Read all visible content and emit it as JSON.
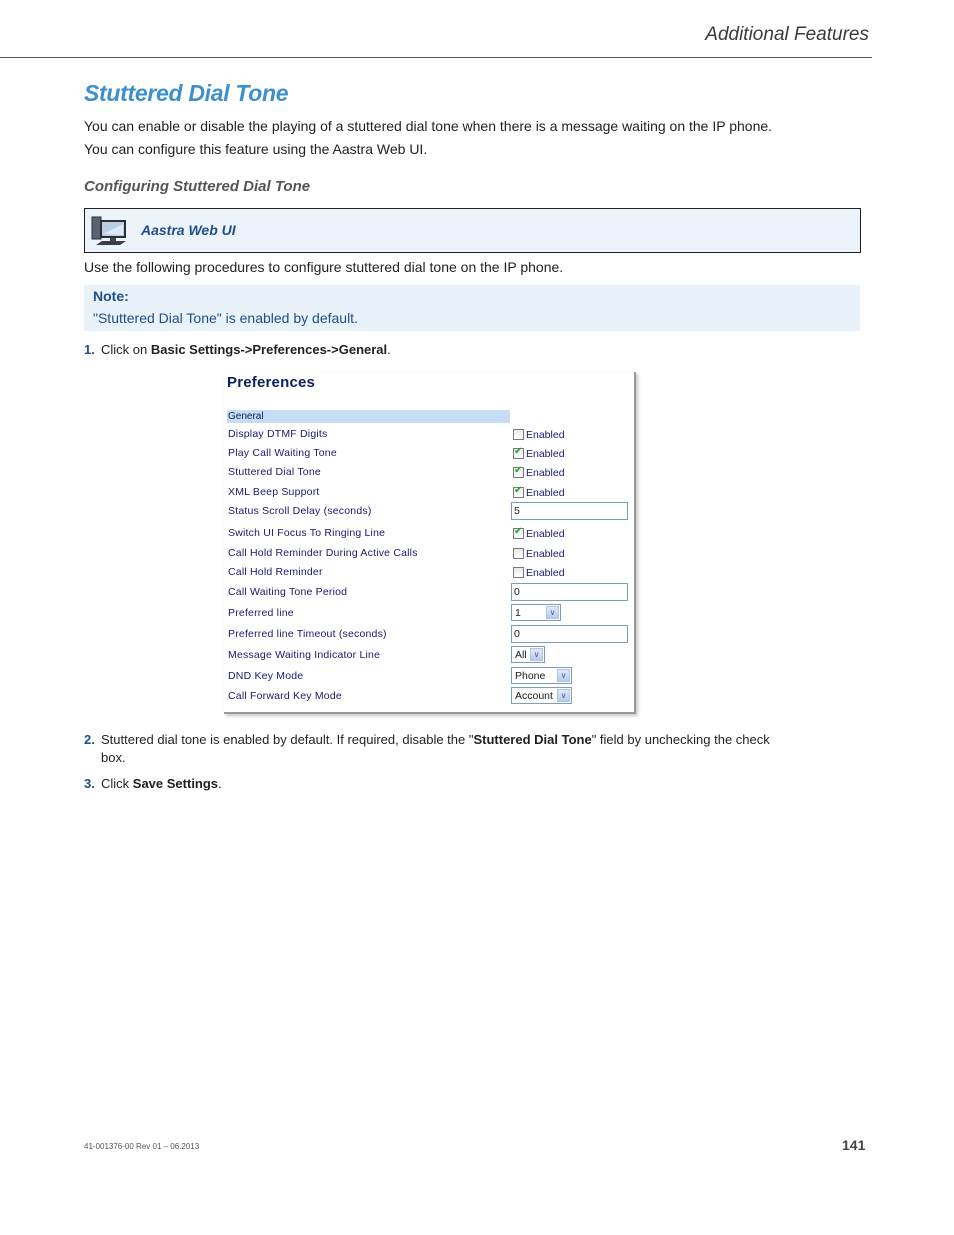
{
  "header": {
    "section_title": "Additional Features"
  },
  "page_title": "Stuttered Dial Tone",
  "intro": [
    "You can enable or disable the playing of a stuttered dial tone when there is a message waiting on the IP phone.",
    "You can configure this feature using the Aastra Web UI."
  ],
  "sub_heading": "Configuring Stuttered Dial Tone",
  "webui_box": {
    "icon": "computer-icon",
    "label": "Aastra Web UI"
  },
  "procedure_intro": "Use the following procedures to configure stuttered dial tone on the IP phone.",
  "note": {
    "title": "Note:",
    "text": "\"Stuttered Dial Tone\" is enabled by default."
  },
  "steps": [
    {
      "num": "1.",
      "pre": "Click on ",
      "bold": "Basic Settings->Preferences->General",
      "post": "."
    },
    {
      "num": "2.",
      "pre": "Stuttered dial tone is enabled by default. If required, disable the \"",
      "bold": "Stuttered Dial Tone",
      "post": "\" field by unchecking the check",
      "post2": "box."
    },
    {
      "num": "3.",
      "pre": "Click ",
      "bold": "Save Settings",
      "post": "."
    }
  ],
  "preferences": {
    "title": "Preferences",
    "section": "General",
    "rows": [
      {
        "label": "Display DTMF Digits",
        "type": "checkbox",
        "checked": false,
        "text": "Enabled"
      },
      {
        "label": "Play Call Waiting Tone",
        "type": "checkbox",
        "checked": true,
        "text": "Enabled"
      },
      {
        "label": "Stuttered Dial Tone",
        "type": "checkbox",
        "checked": true,
        "text": "Enabled"
      },
      {
        "label": "XML Beep Support",
        "type": "checkbox",
        "checked": true,
        "text": "Enabled"
      },
      {
        "label": "Status Scroll Delay (seconds)",
        "type": "text",
        "value": "5"
      },
      {
        "label": "Switch UI Focus To Ringing Line",
        "type": "checkbox",
        "checked": true,
        "text": "Enabled"
      },
      {
        "label": "Call Hold Reminder During Active Calls",
        "type": "checkbox",
        "checked": false,
        "text": "Enabled"
      },
      {
        "label": "Call Hold Reminder",
        "type": "checkbox",
        "checked": false,
        "text": "Enabled"
      },
      {
        "label": "Call Waiting Tone Period",
        "type": "text",
        "value": "0"
      },
      {
        "label": "Preferred line",
        "type": "select",
        "value": "1"
      },
      {
        "label": "Preferred line Timeout (seconds)",
        "type": "text",
        "value": "0"
      },
      {
        "label": "Message Waiting Indicator Line",
        "type": "select",
        "value": "All"
      },
      {
        "label": "DND Key Mode",
        "type": "select",
        "value": "Phone"
      },
      {
        "label": "Call Forward Key Mode",
        "type": "select",
        "value": "Account"
      }
    ]
  },
  "footer": {
    "doc_id": "41-001376-00 Rev 01 – 06.2013",
    "page_number": "141"
  }
}
